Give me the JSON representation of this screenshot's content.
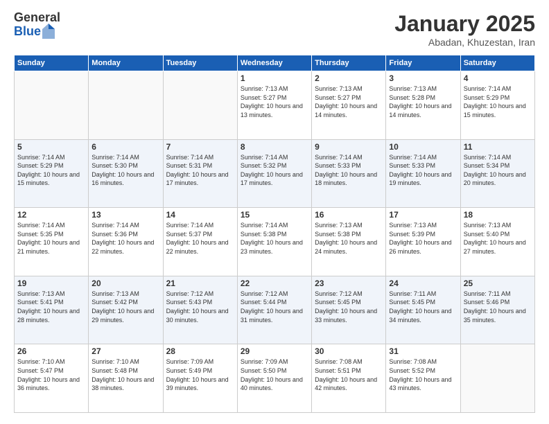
{
  "header": {
    "logo_general": "General",
    "logo_blue": "Blue",
    "month_title": "January 2025",
    "location": "Abadan, Khuzestan, Iran"
  },
  "weekdays": [
    "Sunday",
    "Monday",
    "Tuesday",
    "Wednesday",
    "Thursday",
    "Friday",
    "Saturday"
  ],
  "weeks": [
    [
      {
        "day": "",
        "info": ""
      },
      {
        "day": "",
        "info": ""
      },
      {
        "day": "",
        "info": ""
      },
      {
        "day": "1",
        "info": "Sunrise: 7:13 AM\nSunset: 5:27 PM\nDaylight: 10 hours\nand 13 minutes."
      },
      {
        "day": "2",
        "info": "Sunrise: 7:13 AM\nSunset: 5:27 PM\nDaylight: 10 hours\nand 14 minutes."
      },
      {
        "day": "3",
        "info": "Sunrise: 7:13 AM\nSunset: 5:28 PM\nDaylight: 10 hours\nand 14 minutes."
      },
      {
        "day": "4",
        "info": "Sunrise: 7:14 AM\nSunset: 5:29 PM\nDaylight: 10 hours\nand 15 minutes."
      }
    ],
    [
      {
        "day": "5",
        "info": "Sunrise: 7:14 AM\nSunset: 5:29 PM\nDaylight: 10 hours\nand 15 minutes."
      },
      {
        "day": "6",
        "info": "Sunrise: 7:14 AM\nSunset: 5:30 PM\nDaylight: 10 hours\nand 16 minutes."
      },
      {
        "day": "7",
        "info": "Sunrise: 7:14 AM\nSunset: 5:31 PM\nDaylight: 10 hours\nand 17 minutes."
      },
      {
        "day": "8",
        "info": "Sunrise: 7:14 AM\nSunset: 5:32 PM\nDaylight: 10 hours\nand 17 minutes."
      },
      {
        "day": "9",
        "info": "Sunrise: 7:14 AM\nSunset: 5:33 PM\nDaylight: 10 hours\nand 18 minutes."
      },
      {
        "day": "10",
        "info": "Sunrise: 7:14 AM\nSunset: 5:33 PM\nDaylight: 10 hours\nand 19 minutes."
      },
      {
        "day": "11",
        "info": "Sunrise: 7:14 AM\nSunset: 5:34 PM\nDaylight: 10 hours\nand 20 minutes."
      }
    ],
    [
      {
        "day": "12",
        "info": "Sunrise: 7:14 AM\nSunset: 5:35 PM\nDaylight: 10 hours\nand 21 minutes."
      },
      {
        "day": "13",
        "info": "Sunrise: 7:14 AM\nSunset: 5:36 PM\nDaylight: 10 hours\nand 22 minutes."
      },
      {
        "day": "14",
        "info": "Sunrise: 7:14 AM\nSunset: 5:37 PM\nDaylight: 10 hours\nand 22 minutes."
      },
      {
        "day": "15",
        "info": "Sunrise: 7:14 AM\nSunset: 5:38 PM\nDaylight: 10 hours\nand 23 minutes."
      },
      {
        "day": "16",
        "info": "Sunrise: 7:13 AM\nSunset: 5:38 PM\nDaylight: 10 hours\nand 24 minutes."
      },
      {
        "day": "17",
        "info": "Sunrise: 7:13 AM\nSunset: 5:39 PM\nDaylight: 10 hours\nand 26 minutes."
      },
      {
        "day": "18",
        "info": "Sunrise: 7:13 AM\nSunset: 5:40 PM\nDaylight: 10 hours\nand 27 minutes."
      }
    ],
    [
      {
        "day": "19",
        "info": "Sunrise: 7:13 AM\nSunset: 5:41 PM\nDaylight: 10 hours\nand 28 minutes."
      },
      {
        "day": "20",
        "info": "Sunrise: 7:13 AM\nSunset: 5:42 PM\nDaylight: 10 hours\nand 29 minutes."
      },
      {
        "day": "21",
        "info": "Sunrise: 7:12 AM\nSunset: 5:43 PM\nDaylight: 10 hours\nand 30 minutes."
      },
      {
        "day": "22",
        "info": "Sunrise: 7:12 AM\nSunset: 5:44 PM\nDaylight: 10 hours\nand 31 minutes."
      },
      {
        "day": "23",
        "info": "Sunrise: 7:12 AM\nSunset: 5:45 PM\nDaylight: 10 hours\nand 33 minutes."
      },
      {
        "day": "24",
        "info": "Sunrise: 7:11 AM\nSunset: 5:45 PM\nDaylight: 10 hours\nand 34 minutes."
      },
      {
        "day": "25",
        "info": "Sunrise: 7:11 AM\nSunset: 5:46 PM\nDaylight: 10 hours\nand 35 minutes."
      }
    ],
    [
      {
        "day": "26",
        "info": "Sunrise: 7:10 AM\nSunset: 5:47 PM\nDaylight: 10 hours\nand 36 minutes."
      },
      {
        "day": "27",
        "info": "Sunrise: 7:10 AM\nSunset: 5:48 PM\nDaylight: 10 hours\nand 38 minutes."
      },
      {
        "day": "28",
        "info": "Sunrise: 7:09 AM\nSunset: 5:49 PM\nDaylight: 10 hours\nand 39 minutes."
      },
      {
        "day": "29",
        "info": "Sunrise: 7:09 AM\nSunset: 5:50 PM\nDaylight: 10 hours\nand 40 minutes."
      },
      {
        "day": "30",
        "info": "Sunrise: 7:08 AM\nSunset: 5:51 PM\nDaylight: 10 hours\nand 42 minutes."
      },
      {
        "day": "31",
        "info": "Sunrise: 7:08 AM\nSunset: 5:52 PM\nDaylight: 10 hours\nand 43 minutes."
      },
      {
        "day": "",
        "info": ""
      }
    ]
  ]
}
